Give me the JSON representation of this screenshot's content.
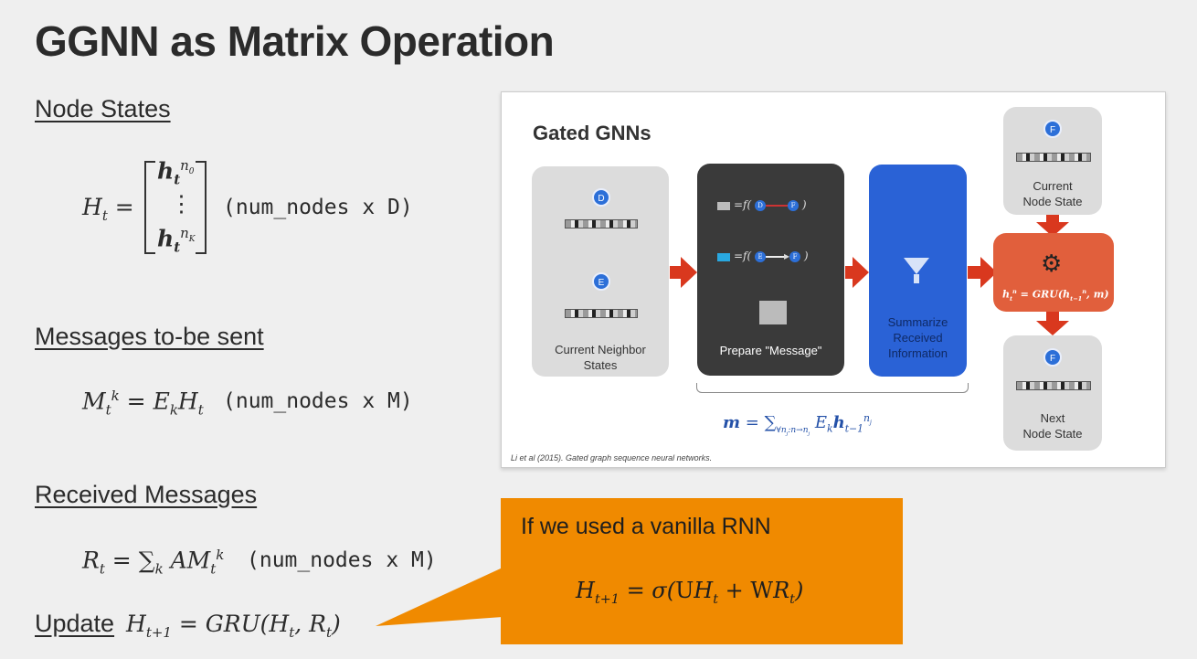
{
  "title": "GGNN as Matrix Operation",
  "sections": {
    "node_states": "Node States",
    "node_states_dim": "(num_nodes x D)",
    "messages": "Messages to-be sent",
    "messages_dim": "(num_nodes x M)",
    "received": "Received Messages",
    "received_dim": "(num_nodes x M)",
    "update": "Update"
  },
  "figure": {
    "title": "Gated GNNs",
    "neighbor_label_1": "Current Neighbor",
    "neighbor_label_2": "States",
    "prepare_label": "Prepare \"Message\"",
    "summarize_1": "Summarize",
    "summarize_2": "Received",
    "summarize_3": "Information",
    "current_1": "Current",
    "current_2": "Node State",
    "next_1": "Next",
    "next_2": "Node State",
    "node_d": "D",
    "node_e": "E",
    "node_f": "F",
    "citation": "Li et al (2015). Gated graph sequence neural networks."
  },
  "callout": {
    "text": "If we used a vanilla RNN"
  },
  "colors": {
    "callout_bg": "#f08a00",
    "arrow": "#d9381e",
    "summarize_panel": "#2a62d6",
    "gru_panel": "#e15f3c"
  }
}
